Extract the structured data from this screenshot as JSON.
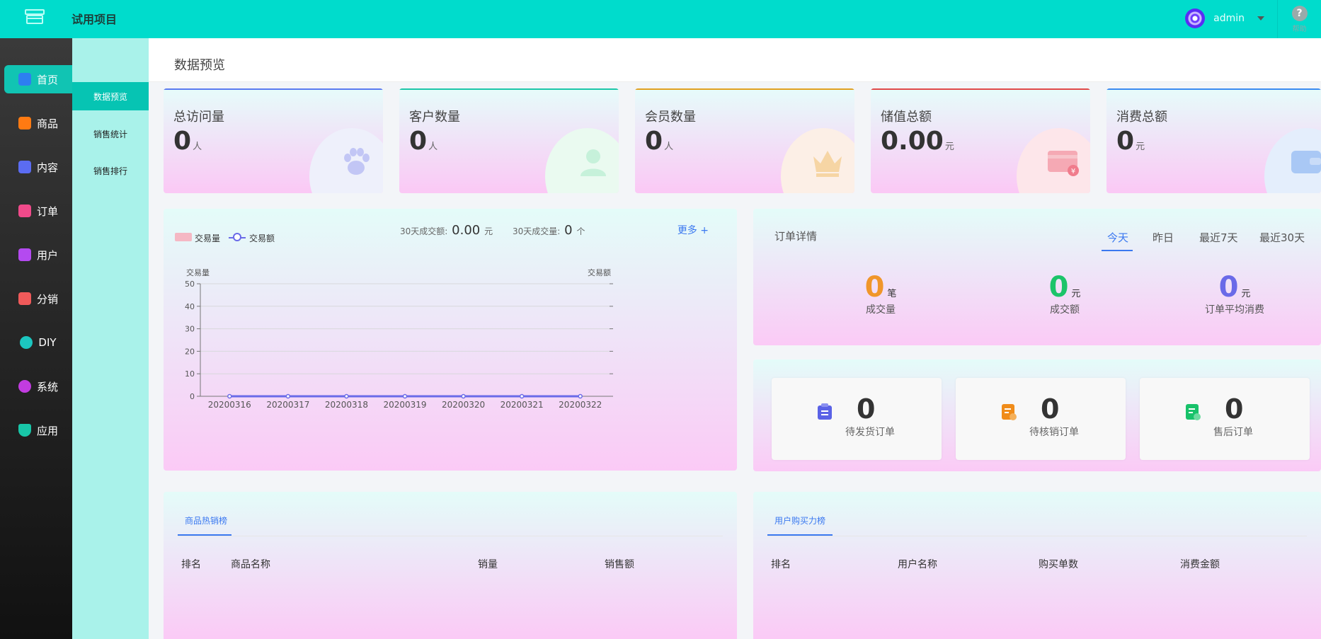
{
  "header": {
    "app_title": "试用项目",
    "username": "admin",
    "help_label": "帮助"
  },
  "sidebar": {
    "items": [
      {
        "label": "首页",
        "icon": "home-icon",
        "color": "#2d7ff0"
      },
      {
        "label": "商品",
        "icon": "shop-icon",
        "color": "#ff7a12"
      },
      {
        "label": "内容",
        "icon": "bag-icon",
        "color": "#5b6cf2"
      },
      {
        "label": "订单",
        "icon": "order-icon",
        "color": "#f04a8a"
      },
      {
        "label": "用户",
        "icon": "user-icon",
        "color": "#b44af0"
      },
      {
        "label": "分销",
        "icon": "coins-icon",
        "color": "#f05a5a"
      },
      {
        "label": "DIY",
        "icon": "pie-icon",
        "color": "#1cc6c0"
      },
      {
        "label": "系统",
        "icon": "system-icon",
        "color": "#c23ce0"
      },
      {
        "label": "应用",
        "icon": "shield-icon",
        "color": "#18c6a8"
      }
    ]
  },
  "submenu": {
    "items": [
      {
        "label": "数据预览"
      },
      {
        "label": "销售统计"
      },
      {
        "label": "销售排行"
      }
    ]
  },
  "page": {
    "title": "数据预览"
  },
  "stats": [
    {
      "label": "总访问量",
      "value": "0",
      "unit": "人",
      "icon": "paw-icon",
      "accent": "#5a7af0"
    },
    {
      "label": "客户数量",
      "value": "0",
      "unit": "人",
      "icon": "customers-icon",
      "accent": "#1cc6a8"
    },
    {
      "label": "会员数量",
      "value": "0",
      "unit": "人",
      "icon": "crown-icon",
      "accent": "#e0a020"
    },
    {
      "label": "储值总额",
      "value": "0.00",
      "unit": "元",
      "icon": "card-icon",
      "accent": "#e04848"
    },
    {
      "label": "消费总额",
      "value": "0",
      "unit": "元",
      "icon": "wallet-icon",
      "accent": "#3a8af0"
    }
  ],
  "chart_panel": {
    "legend_bar": "交易量",
    "legend_line": "交易额",
    "summary_amount_label": "30天成交额:",
    "summary_amount_value": "0.00",
    "summary_amount_unit": "元",
    "summary_count_label": "30天成交量:",
    "summary_count_value": "0",
    "summary_count_unit": "个",
    "more_label": "更多 +"
  },
  "chart_data": {
    "type": "bar",
    "categories": [
      "20200316",
      "20200317",
      "20200318",
      "20200319",
      "20200320",
      "20200321",
      "20200322"
    ],
    "series": [
      {
        "name": "交易量",
        "values": [
          0,
          0,
          0,
          0,
          0,
          0,
          0
        ]
      },
      {
        "name": "交易额",
        "values": [
          0,
          0,
          0,
          0,
          0,
          0,
          0
        ]
      }
    ],
    "ylabel_left": "交易量",
    "ylabel_right": "交易额",
    "ylim": [
      0,
      50
    ],
    "yticks": [
      0,
      10,
      20,
      30,
      40,
      50
    ],
    "grid": true,
    "legend": "top-left",
    "bar_color": "#f5b8c4",
    "line_color": "#6a6ae8"
  },
  "order_detail": {
    "title": "订单详情",
    "tabs": [
      "今天",
      "昨日",
      "最近7天",
      "最近30天"
    ],
    "metrics": [
      {
        "value": "0",
        "unit": "笔",
        "label": "成交量",
        "color": "#f0962a"
      },
      {
        "value": "0",
        "unit": "元",
        "label": "成交额",
        "color": "#1cc46a"
      },
      {
        "value": "0",
        "unit": "元",
        "label": "订单平均消费",
        "color": "#6a6ae8"
      }
    ]
  },
  "pending": [
    {
      "value": "0",
      "label": "待发货订单",
      "icon": "clipboard-icon",
      "color": "#5a62e6"
    },
    {
      "value": "0",
      "label": "待核销订单",
      "icon": "verify-icon",
      "color": "#f08c1a"
    },
    {
      "value": "0",
      "label": "售后订单",
      "icon": "aftersale-icon",
      "color": "#18c26a"
    }
  ],
  "goods_rank": {
    "tab": "商品热销榜",
    "columns": [
      "排名",
      "商品名称",
      "销量",
      "销售额"
    ]
  },
  "user_rank": {
    "tab": "用户购买力榜",
    "columns": [
      "排名",
      "用户名称",
      "购买单数",
      "消费金额"
    ]
  }
}
